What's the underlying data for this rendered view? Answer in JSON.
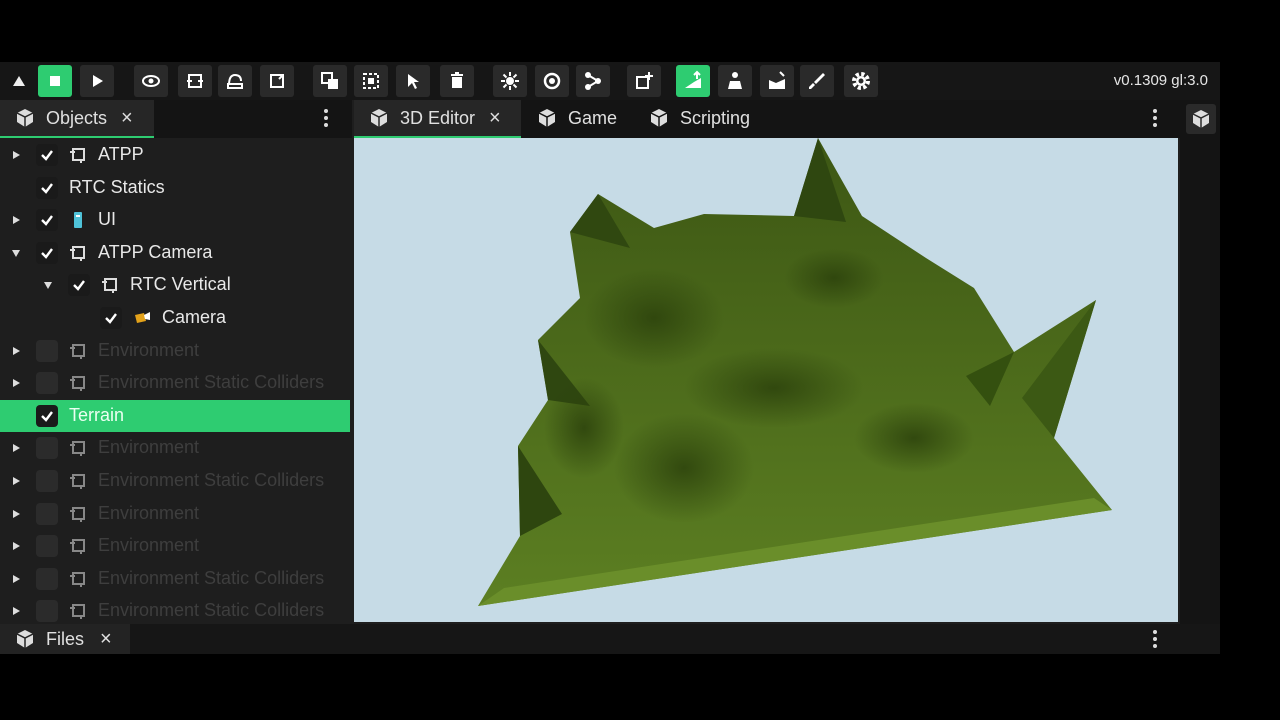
{
  "version": "v0.1309 gl:3.0",
  "toolbar": {
    "icons": [
      "triangle-up-icon",
      "stop-icon",
      "play-icon",
      "eye-icon",
      "move-icon",
      "rotate-icon",
      "scale-icon",
      "duplicate-icon",
      "select-box-icon",
      "pointer-icon",
      "trash-icon",
      "light-icon",
      "sphere-icon",
      "node-graph-icon",
      "add-object-icon",
      "terrain-raise-icon",
      "terrain-paint-icon",
      "terrain-flatten-icon",
      "brush-icon",
      "settings-gear-icon"
    ]
  },
  "left_tabs": {
    "objects_label": "Objects",
    "close": "×"
  },
  "editor_tabs": [
    {
      "label": "3D Editor",
      "active": true,
      "close": "×"
    },
    {
      "label": "Game",
      "active": false
    },
    {
      "label": "Scripting",
      "active": false
    }
  ],
  "tree": [
    {
      "label": "ATPP",
      "checked": true,
      "expand": "collapsed",
      "icon": "group",
      "indent": 0,
      "dim": false
    },
    {
      "label": "RTC Statics",
      "checked": true,
      "expand": "none",
      "icon": "none",
      "indent": 0,
      "dim": false
    },
    {
      "label": "UI",
      "checked": true,
      "expand": "collapsed",
      "icon": "ui",
      "indent": 0,
      "dim": false
    },
    {
      "label": "ATPP Camera",
      "checked": true,
      "expand": "expanded",
      "icon": "group",
      "indent": 0,
      "dim": false
    },
    {
      "label": "RTC Vertical",
      "checked": true,
      "expand": "expanded",
      "icon": "group",
      "indent": 1,
      "dim": false
    },
    {
      "label": "Camera",
      "checked": true,
      "expand": "none",
      "icon": "camera",
      "indent": 2,
      "dim": false
    },
    {
      "label": "Environment",
      "checked": false,
      "expand": "collapsed",
      "icon": "group",
      "indent": 0,
      "dim": true
    },
    {
      "label": "Environment Static Colliders",
      "checked": false,
      "expand": "collapsed",
      "icon": "group",
      "indent": 0,
      "dim": true
    },
    {
      "label": "Terrain",
      "checked": true,
      "expand": "none",
      "icon": "none",
      "indent": 0,
      "dim": false,
      "selected": true
    },
    {
      "label": "Environment",
      "checked": false,
      "expand": "collapsed",
      "icon": "group",
      "indent": 0,
      "dim": true
    },
    {
      "label": "Environment Static Colliders",
      "checked": false,
      "expand": "collapsed",
      "icon": "group",
      "indent": 0,
      "dim": true
    },
    {
      "label": "Environment",
      "checked": false,
      "expand": "collapsed",
      "icon": "group",
      "indent": 0,
      "dim": true
    },
    {
      "label": "Environment",
      "checked": false,
      "expand": "collapsed",
      "icon": "group",
      "indent": 0,
      "dim": true
    },
    {
      "label": "Environment Static Colliders",
      "checked": false,
      "expand": "collapsed",
      "icon": "group",
      "indent": 0,
      "dim": true
    },
    {
      "label": "Environment Static Colliders",
      "checked": false,
      "expand": "collapsed",
      "icon": "group",
      "indent": 0,
      "dim": true
    }
  ],
  "bottom_tab": {
    "label": "Files",
    "close": "×"
  },
  "colors": {
    "accent": "#2ecc71",
    "viewport_bg": "#c6dbe6",
    "terrain": "#4e6b1c"
  }
}
